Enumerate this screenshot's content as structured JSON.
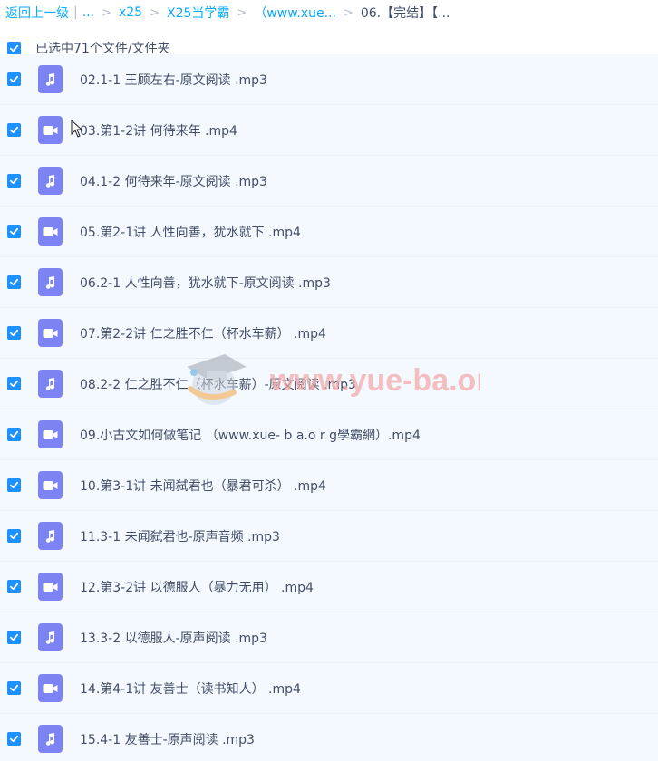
{
  "breadcrumb": {
    "back": "返回上一级",
    "pipe": "|",
    "ellipsis": "...",
    "sep": ">",
    "items": [
      "x25",
      "X25当学霸",
      "（www.xue...",
      "06.【完结】【..."
    ]
  },
  "selection": {
    "text": "已选中71个文件/文件夹"
  },
  "files": [
    {
      "name": "02.1-1 王顾左右-原文阅读 .mp3",
      "type": "audio"
    },
    {
      "name": "03.第1-2讲 何待来年 .mp4",
      "type": "video"
    },
    {
      "name": "04.1-2 何待来年-原文阅读 .mp3",
      "type": "audio"
    },
    {
      "name": "05.第2-1讲 人性向善，犹水就下 .mp4",
      "type": "video"
    },
    {
      "name": "06.2-1 人性向善，犹水就下-原文阅读 .mp3",
      "type": "audio"
    },
    {
      "name": "07.第2-2讲 仁之胜不仁（杯水车薪） .mp4",
      "type": "video"
    },
    {
      "name": "08.2-2 仁之胜不仁（杯水车薪）-原文阅读 .mp3",
      "type": "audio"
    },
    {
      "name": "09.小古文如何做笔记 （www.xue- b a.o r g學霸網）.mp4",
      "type": "video"
    },
    {
      "name": "10.第3-1讲 未闻弑君也（暴君可杀） .mp4",
      "type": "video"
    },
    {
      "name": "11.3-1 未闻弑君也-原声音频 .mp3",
      "type": "audio"
    },
    {
      "name": "12.第3-2讲 以德服人（暴力无用） .mp4",
      "type": "video"
    },
    {
      "name": "13.3-2 以德服人-原声阅读 .mp3",
      "type": "audio"
    },
    {
      "name": "14.第4-1讲 友善士（读书知人） .mp4",
      "type": "video"
    },
    {
      "name": "15.4-1 友善士-原声阅读 .mp3",
      "type": "audio"
    }
  ],
  "watermark": {
    "text": "www.yue-ba.org"
  },
  "colors": {
    "accent": "#1e90ff",
    "link": "#09aaff",
    "file_icon": "#7b84f2",
    "row_bg": "#f4f9ff",
    "text": "#424e67"
  }
}
